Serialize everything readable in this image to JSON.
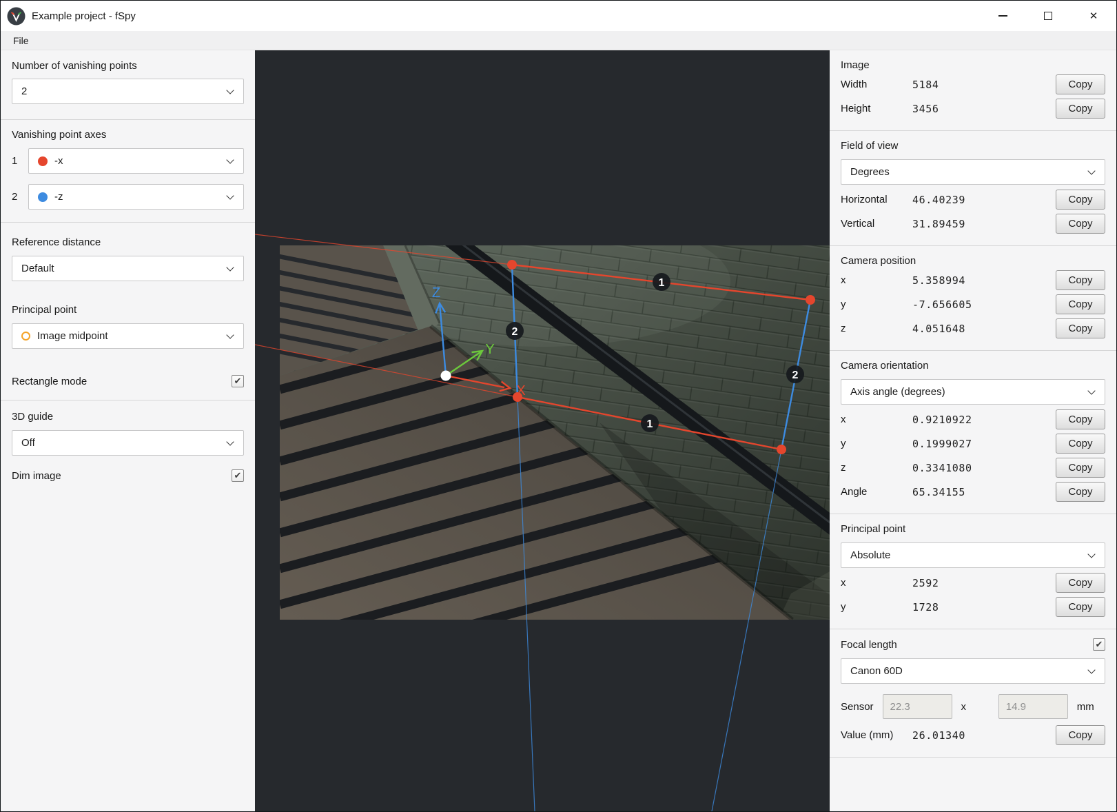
{
  "window": {
    "title": "Example project - fSpy"
  },
  "menu": {
    "items": [
      {
        "label": "File"
      }
    ]
  },
  "left_panel": {
    "vanishing_points": {
      "label": "Number of vanishing points",
      "value": "2"
    },
    "axes": {
      "label": "Vanishing point axes",
      "rows": [
        {
          "index": "1",
          "value": "-x"
        },
        {
          "index": "2",
          "value": "-z"
        }
      ]
    },
    "reference_distance": {
      "label": "Reference distance",
      "value": "Default"
    },
    "principal_point": {
      "label": "Principal point",
      "value": "Image midpoint"
    },
    "rectangle_mode": {
      "label": "Rectangle mode",
      "checked": true,
      "check_glyph": "✔"
    },
    "guide_3d": {
      "label": "3D guide",
      "value": "Off"
    },
    "dim_image": {
      "label": "Dim image",
      "checked": true,
      "check_glyph": "✔"
    }
  },
  "right_panel": {
    "copy_label": "Copy",
    "image": {
      "title": "Image",
      "rows": [
        {
          "label": "Width",
          "value": "5184"
        },
        {
          "label": "Height",
          "value": "3456"
        }
      ]
    },
    "field_of_view": {
      "title": "Field of view",
      "mode": "Degrees",
      "rows": [
        {
          "label": "Horizontal",
          "value": "46.40239"
        },
        {
          "label": "Vertical",
          "value": "31.89459"
        }
      ]
    },
    "camera_position": {
      "title": "Camera position",
      "rows": [
        {
          "label": "x",
          "value": "5.358994"
        },
        {
          "label": "y",
          "value": "-7.656605"
        },
        {
          "label": "z",
          "value": "4.051648"
        }
      ]
    },
    "camera_orientation": {
      "title": "Camera orientation",
      "mode": "Axis angle (degrees)",
      "rows": [
        {
          "label": "x",
          "value": "0.9210922"
        },
        {
          "label": "y",
          "value": "0.1999027"
        },
        {
          "label": "z",
          "value": "0.3341080"
        },
        {
          "label": "Angle",
          "value": "65.34155"
        }
      ]
    },
    "principal_point": {
      "title": "Principal point",
      "mode": "Absolute",
      "rows": [
        {
          "label": "x",
          "value": "2592"
        },
        {
          "label": "y",
          "value": "1728"
        }
      ]
    },
    "focal_length": {
      "title": "Focal length",
      "checked": true,
      "check_glyph": "✔",
      "camera": "Canon 60D",
      "sensor_label": "Sensor",
      "sensor_width": "22.3",
      "separator": "x",
      "sensor_height": "14.9",
      "unit": "mm",
      "value_label": "Value (mm)",
      "value": "26.01340"
    }
  },
  "viewport": {
    "badges": [
      {
        "label": "1"
      },
      {
        "label": "2"
      },
      {
        "label": "1"
      },
      {
        "label": "2"
      }
    ],
    "axis_labels": {
      "x": "X",
      "y": "Y",
      "z": "Z"
    },
    "colors": {
      "vp1": "#e5462d",
      "vp2": "#3d8be0",
      "axis_y": "#6cc83c",
      "origin": "#ffffff",
      "pp_ring": "#f5a327"
    }
  }
}
